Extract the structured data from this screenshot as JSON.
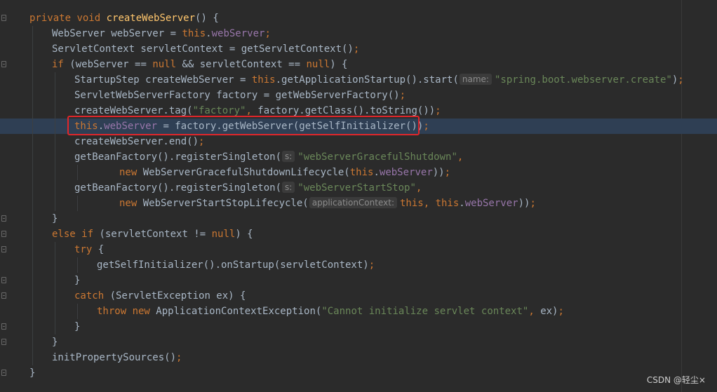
{
  "editor": {
    "lines": [
      [
        {
          "t": "private ",
          "c": "kw"
        },
        {
          "t": "void ",
          "c": "kw"
        },
        {
          "t": "createWebServer",
          "c": "fn"
        },
        {
          "t": "() {"
        }
      ],
      [
        {
          "t": "WebServer webServer = "
        },
        {
          "t": "this",
          "c": "kw"
        },
        {
          "t": "."
        },
        {
          "t": "webServer",
          "c": "fld"
        },
        {
          "t": ";",
          "c": "kw"
        }
      ],
      [
        {
          "t": "ServletContext servletContext = getServletContext()"
        },
        {
          "t": ";",
          "c": "kw"
        }
      ],
      [
        {
          "t": "if ",
          "c": "kw"
        },
        {
          "t": "(webServer == "
        },
        {
          "t": "null ",
          "c": "kw"
        },
        {
          "t": "&& servletContext == "
        },
        {
          "t": "null",
          "c": "kw"
        },
        {
          "t": ") {"
        }
      ],
      [
        {
          "t": "StartupStep createWebServer = "
        },
        {
          "t": "this",
          "c": "kw"
        },
        {
          "t": ".getApplicationStartup().start("
        },
        {
          "t": "name:",
          "c": "hint"
        },
        {
          "t": "\"spring.boot.webserver.create\"",
          "c": "str"
        },
        {
          "t": ")"
        },
        {
          "t": ";",
          "c": "kw"
        }
      ],
      [
        {
          "t": "ServletWebServerFactory factory = getWebServerFactory()"
        },
        {
          "t": ";",
          "c": "kw"
        }
      ],
      [
        {
          "t": "createWebServer.tag("
        },
        {
          "t": "\"factory\"",
          "c": "str"
        },
        {
          "t": ", ",
          "c": "kw"
        },
        {
          "t": "factory.getClass().toString())"
        },
        {
          "t": ";",
          "c": "kw"
        }
      ],
      [
        {
          "t": "this",
          "c": "kw"
        },
        {
          "t": "."
        },
        {
          "t": "webServer",
          "c": "fld"
        },
        {
          "t": " = factory.getWebServer(getSelfInitializer())"
        },
        {
          "t": ";",
          "c": "kw"
        }
      ],
      [
        {
          "t": "createWebServer.end()"
        },
        {
          "t": ";",
          "c": "kw"
        }
      ],
      [
        {
          "t": "getBeanFactory().registerSingleton("
        },
        {
          "t": "s:",
          "c": "hint"
        },
        {
          "t": "\"webServerGracefulShutdown\"",
          "c": "str"
        },
        {
          "t": ",",
          "c": "kw"
        }
      ],
      [
        {
          "t": "new ",
          "c": "kw"
        },
        {
          "t": "WebServerGracefulShutdownLifecycle("
        },
        {
          "t": "this",
          "c": "kw"
        },
        {
          "t": "."
        },
        {
          "t": "webServer",
          "c": "fld"
        },
        {
          "t": "))"
        },
        {
          "t": ";",
          "c": "kw"
        }
      ],
      [
        {
          "t": "getBeanFactory().registerSingleton("
        },
        {
          "t": "s:",
          "c": "hint"
        },
        {
          "t": "\"webServerStartStop\"",
          "c": "str"
        },
        {
          "t": ",",
          "c": "kw"
        }
      ],
      [
        {
          "t": "new ",
          "c": "kw"
        },
        {
          "t": "WebServerStartStopLifecycle("
        },
        {
          "t": "applicationContext:",
          "c": "hint"
        },
        {
          "t": "this",
          "c": "kw"
        },
        {
          "t": ", ",
          "c": "kw"
        },
        {
          "t": "this",
          "c": "kw"
        },
        {
          "t": "."
        },
        {
          "t": "webServer",
          "c": "fld"
        },
        {
          "t": "))"
        },
        {
          "t": ";",
          "c": "kw"
        }
      ],
      [
        {
          "t": "}"
        }
      ],
      [
        {
          "t": "else if ",
          "c": "kw"
        },
        {
          "t": "(servletContext != "
        },
        {
          "t": "null",
          "c": "kw"
        },
        {
          "t": ") {"
        }
      ],
      [
        {
          "t": "try ",
          "c": "kw"
        },
        {
          "t": "{"
        }
      ],
      [
        {
          "t": "getSelfInitializer().onStartup(servletContext)"
        },
        {
          "t": ";",
          "c": "kw"
        }
      ],
      [
        {
          "t": "}"
        }
      ],
      [
        {
          "t": "catch ",
          "c": "kw"
        },
        {
          "t": "(ServletException ex) {"
        }
      ],
      [
        {
          "t": "throw new ",
          "c": "kw"
        },
        {
          "t": "ApplicationContextException("
        },
        {
          "t": "\"Cannot initialize servlet context\"",
          "c": "str"
        },
        {
          "t": ", ",
          "c": "kw"
        },
        {
          "t": "ex)"
        },
        {
          "t": ";",
          "c": "kw"
        }
      ],
      [
        {
          "t": "}"
        }
      ],
      [
        {
          "t": "}"
        }
      ],
      [
        {
          "t": "initPropertySources()"
        },
        {
          "t": ";",
          "c": "kw"
        }
      ],
      [
        {
          "t": "}"
        }
      ]
    ],
    "current_line": 7
  },
  "watermark": "CSDN @轻尘×",
  "colors": {
    "background": "#2b2b2b",
    "keyword": "#cc7832",
    "method": "#ffc66d",
    "field": "#9876aa",
    "string": "#6a8759",
    "text": "#a9b7c6",
    "highlight_box": "#e0262a"
  }
}
